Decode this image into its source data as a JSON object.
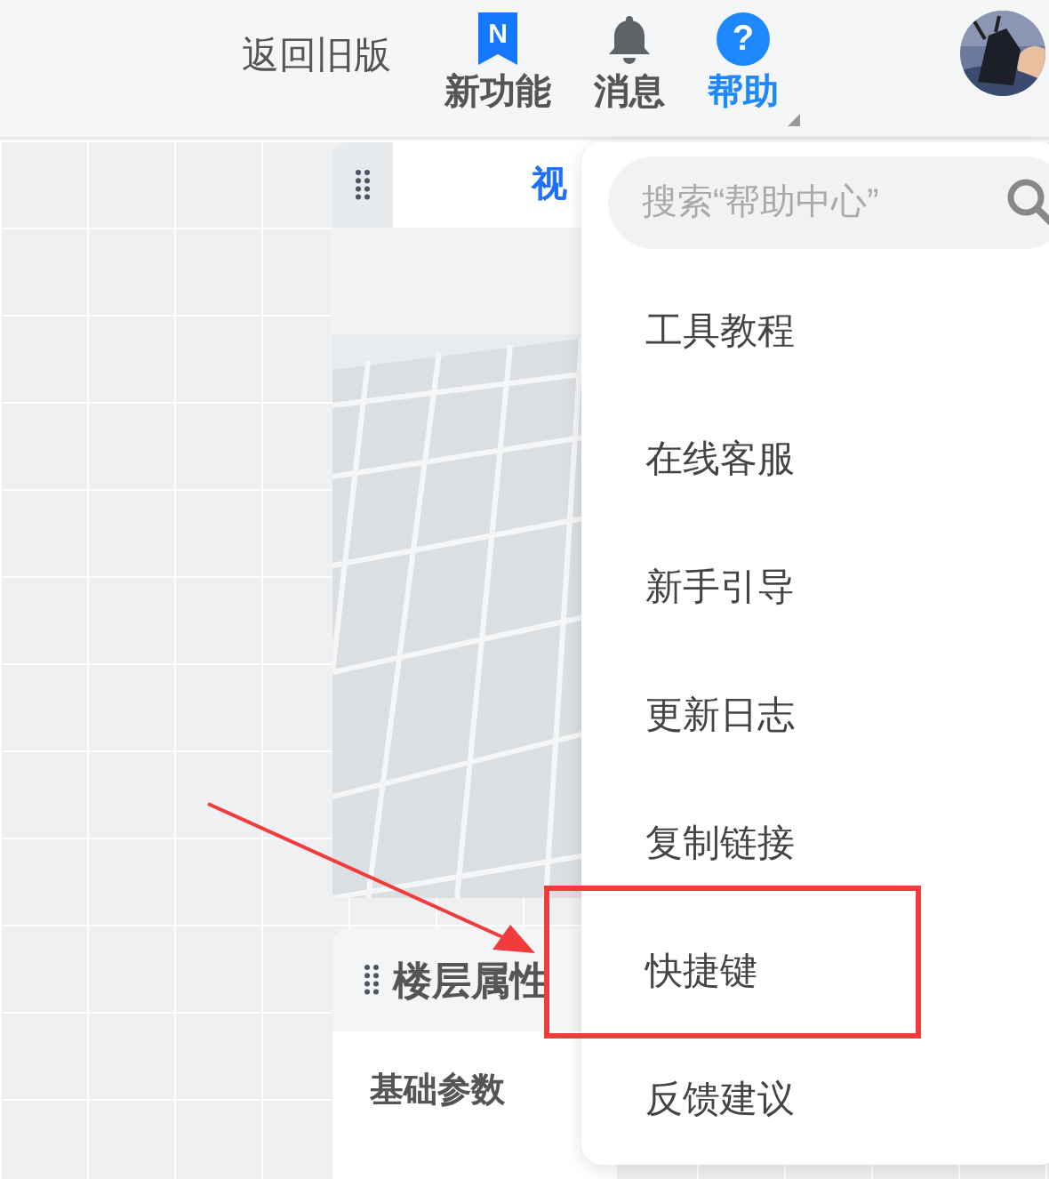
{
  "header": {
    "back_link": "返回旧版",
    "nav": [
      {
        "kind": "badge",
        "label": "新功能",
        "badge": "N",
        "selected": false
      },
      {
        "kind": "bell",
        "label": "消息",
        "selected": false
      },
      {
        "kind": "help",
        "label": "帮助",
        "badge": "?",
        "selected": true
      }
    ]
  },
  "view_panel": {
    "title": "视"
  },
  "floor_panel": {
    "title": "楼层属性",
    "section": "基础参数"
  },
  "help_menu": {
    "search": {
      "placeholder": "搜索“帮助中心”"
    },
    "items": [
      {
        "label": "工具教程",
        "highlighted": false
      },
      {
        "label": "在线客服",
        "highlighted": false
      },
      {
        "label": "新手引导",
        "highlighted": false
      },
      {
        "label": "更新日志",
        "highlighted": false
      },
      {
        "label": "复制链接",
        "highlighted": false
      },
      {
        "label": "快捷键",
        "highlighted": true
      },
      {
        "label": "反馈建议",
        "highlighted": false
      }
    ]
  }
}
